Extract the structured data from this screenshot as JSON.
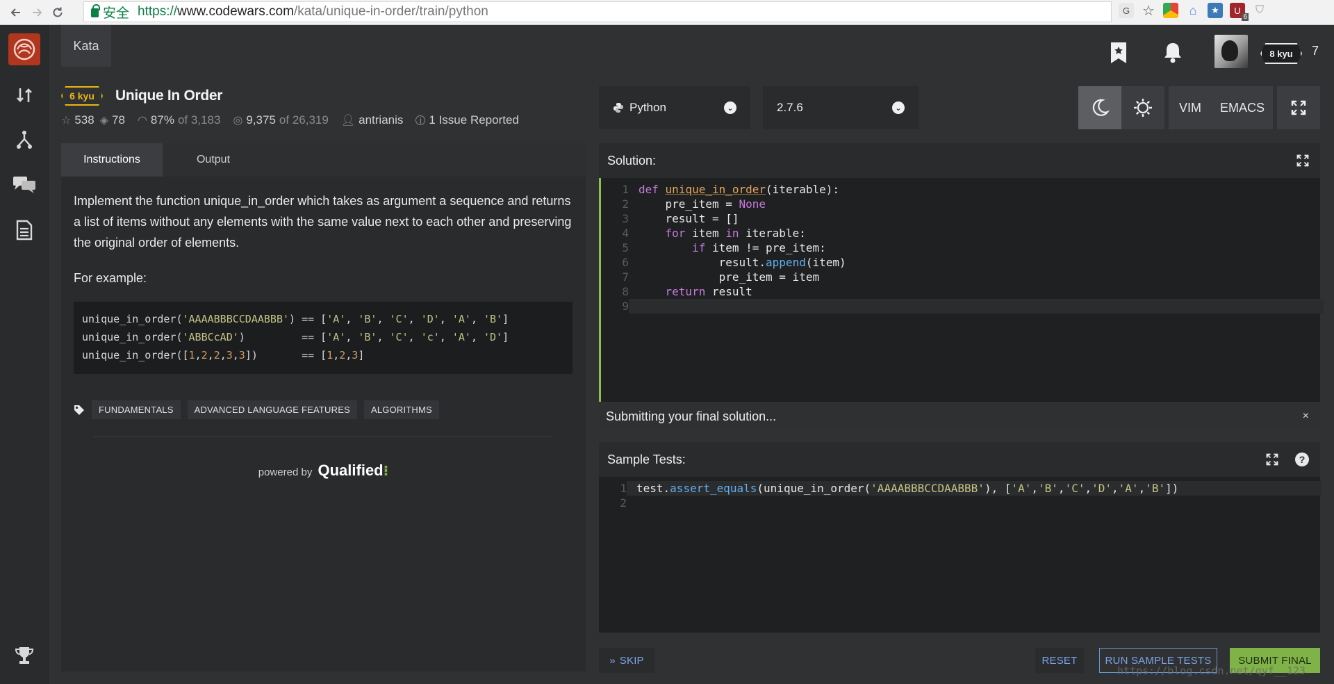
{
  "browser": {
    "secure_label": "安全",
    "url_scheme": "https://",
    "url_host": "www.codewars.com",
    "url_path": "/kata/unique-in-order/train/python",
    "ext_badge": "6"
  },
  "header": {
    "kata_tab": "Kata",
    "rank_badge": "8 kyu",
    "honor": "7"
  },
  "kata": {
    "kyu": "6 kyu",
    "title": "Unique In Order",
    "stars": "538",
    "collections": "78",
    "satisfaction": "87%",
    "satisfaction_of": "of 3,183",
    "completed": "9,375",
    "completed_of": "of 26,319",
    "author": "antrianis",
    "issues": "1 Issue Reported"
  },
  "left_tabs": [
    "Instructions",
    "Output"
  ],
  "instructions": {
    "description": "Implement the function unique_in_order which takes as argument a sequence and returns a list of items without any elements with the same value next to each other and preserving the original order of elements.",
    "example_label": "For example:",
    "tags": [
      "FUNDAMENTALS",
      "ADVANCED LANGUAGE FEATURES",
      "ALGORITHMS"
    ],
    "powered_prefix": "powered by",
    "powered_brand": "Qualified"
  },
  "editor_controls": {
    "language": "Python",
    "version": "2.7.6",
    "vim": "VIM",
    "emacs": "EMACS"
  },
  "solution": {
    "heading": "Solution:",
    "line_numbers": [
      "1",
      "2",
      "3",
      "4",
      "5",
      "6",
      "7",
      "8",
      "9"
    ]
  },
  "notice": "Submitting your final solution...",
  "notice_close": "×",
  "sample_tests": {
    "heading": "Sample Tests:",
    "line_numbers": [
      "1",
      "2"
    ]
  },
  "buttons": {
    "skip": "SKIP",
    "reset": "RESET",
    "run_sample_tests": "RUN SAMPLE TESTS",
    "submit_final": "SUBMIT FINAL"
  },
  "watermark": "https://blog.csdn.net/qyf__123",
  "colors": {
    "kyu_yellow": "#ecb613",
    "submit_green": "#7fb347",
    "run_blue": "#6795de",
    "logo_red": "#b1361e"
  }
}
